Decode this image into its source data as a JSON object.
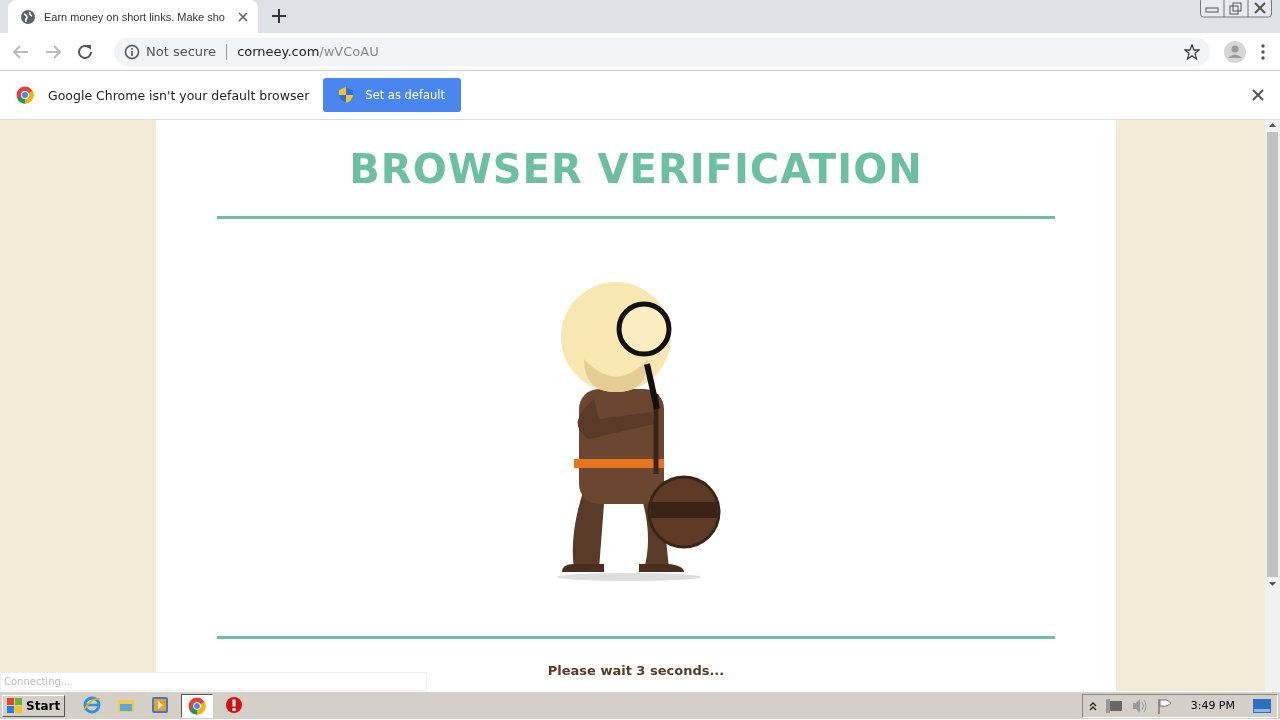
{
  "browser": {
    "tabs": [
      {
        "title": "Earn money on short links. Make sho",
        "selected": true
      }
    ],
    "address": {
      "security": "Not secure",
      "host": "corneey.com",
      "path": "/wVCoAU"
    }
  },
  "infobar": {
    "message": "Google Chrome isn't your default browser",
    "button": "Set as default"
  },
  "page": {
    "heading": "BROWSER VERIFICATION",
    "wait_text": "Please wait 3 seconds..."
  },
  "status": "Connecting...",
  "taskbar": {
    "start": "Start",
    "clock": "3:49 PM",
    "apps": [
      {
        "kind": "ie",
        "selected": false
      },
      {
        "kind": "folder",
        "selected": false
      },
      {
        "kind": "media",
        "selected": false
      },
      {
        "kind": "chrome",
        "selected": true
      },
      {
        "kind": "stop",
        "selected": false
      }
    ]
  }
}
